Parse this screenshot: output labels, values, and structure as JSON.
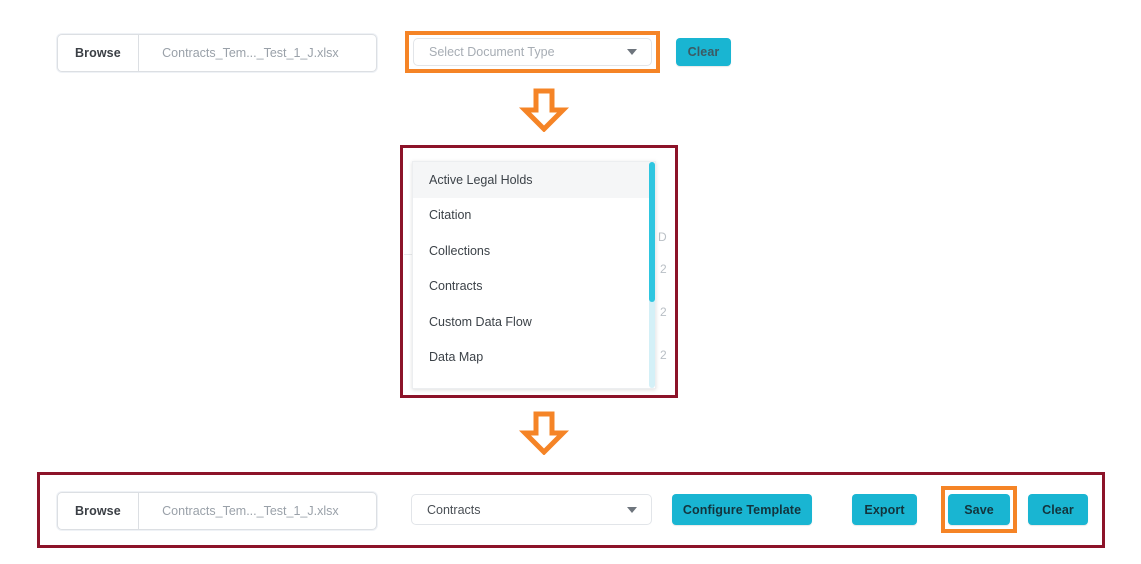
{
  "top_row": {
    "browse_label": "Browse",
    "file_name": "Contracts_Tem..._Test_1_J.xlsx",
    "document_type_placeholder": "Select Document Type",
    "clear_label": "Clear"
  },
  "dropdown": {
    "items": [
      {
        "label": "Active Legal Holds",
        "selected": true
      },
      {
        "label": "Citation",
        "selected": false
      },
      {
        "label": "Collections",
        "selected": false
      },
      {
        "label": "Contracts",
        "selected": false
      },
      {
        "label": "Custom Data Flow",
        "selected": false
      },
      {
        "label": "Data Map",
        "selected": false
      }
    ],
    "background_fragments": [
      "D",
      "2",
      "2",
      "2"
    ]
  },
  "bottom_row": {
    "browse_label": "Browse",
    "file_name": "Contracts_Tem..._Test_1_J.xlsx",
    "document_type_value": "Contracts",
    "configure_template_label": "Configure Template",
    "export_label": "Export",
    "save_label": "Save",
    "clear_label": "Clear"
  },
  "annotations": {
    "arrow_top": "down-arrow",
    "arrow_bottom": "down-arrow",
    "highlight_color": "#F58426",
    "callout_color": "#8C1329",
    "button_color": "#19B5D2"
  }
}
